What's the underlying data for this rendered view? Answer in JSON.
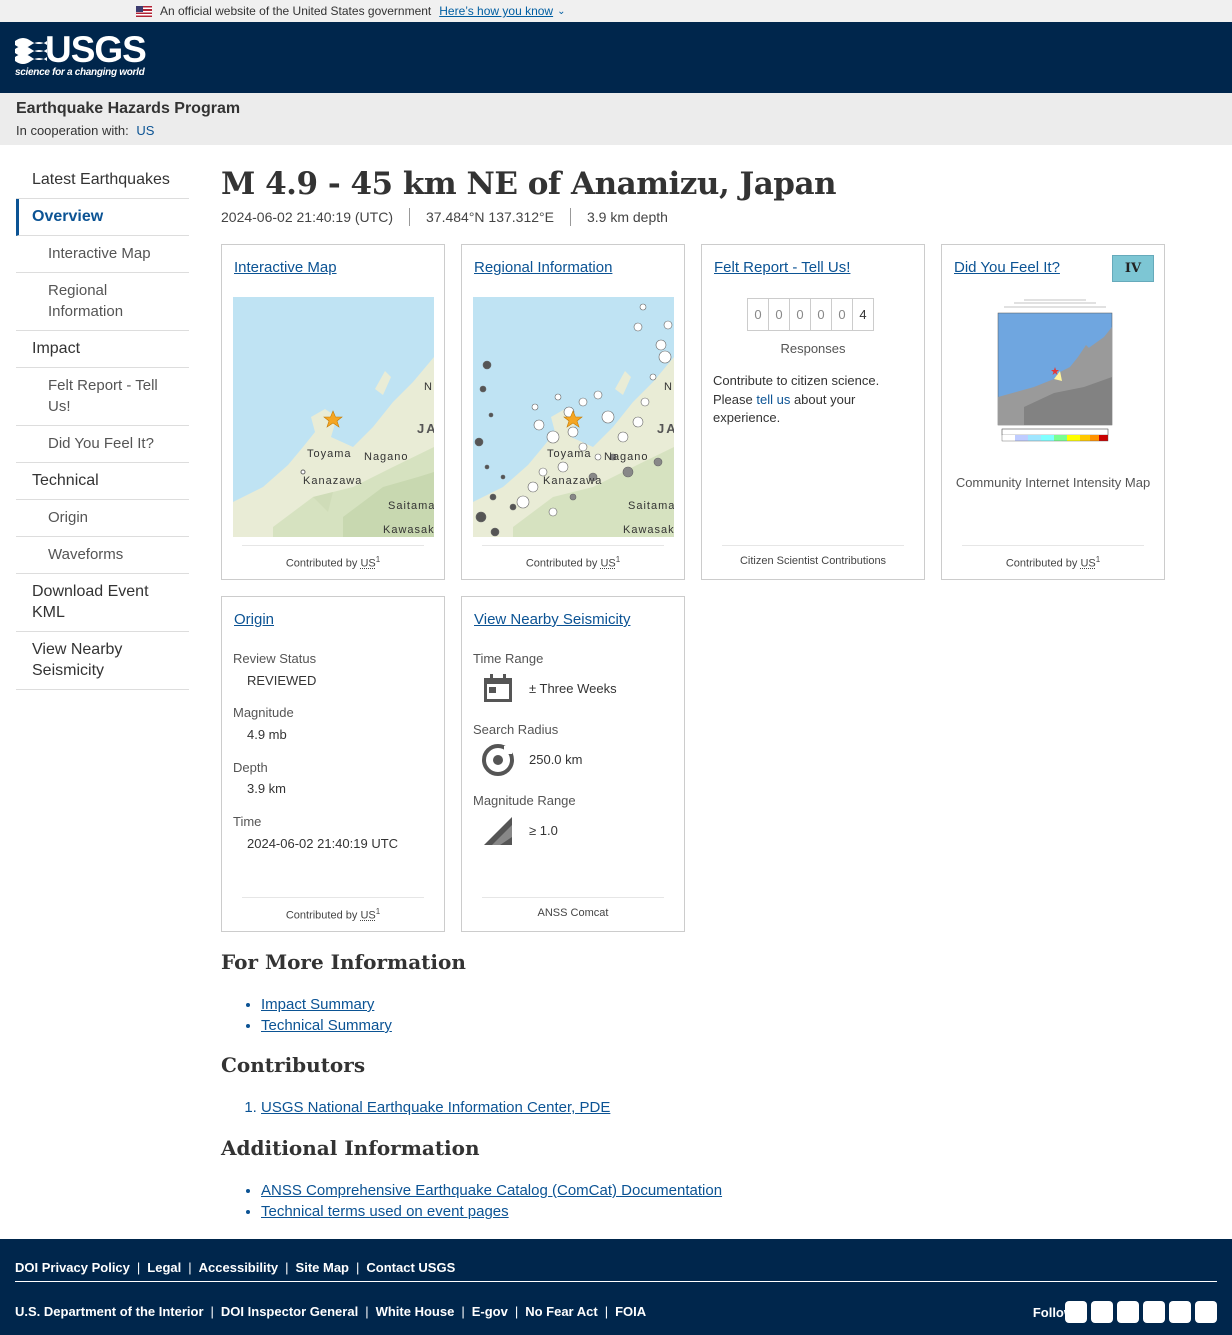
{
  "gov_banner": {
    "text": "An official website of the United States government",
    "link": "Here’s how you know"
  },
  "logo": {
    "wordmark": "USGS",
    "tagline": "science for a changing world"
  },
  "site_header": {
    "program": "Earthquake Hazards Program",
    "coop_label": "In cooperation with:",
    "coop_link": "US"
  },
  "sidebar": {
    "items": [
      {
        "label": "Latest Earthquakes"
      },
      {
        "label": "Overview"
      },
      {
        "label": "Interactive Map"
      },
      {
        "label": "Regional Information"
      },
      {
        "label": "Impact"
      },
      {
        "label": "Felt Report - Tell Us!"
      },
      {
        "label": "Did You Feel It?"
      },
      {
        "label": "Technical"
      },
      {
        "label": "Origin"
      },
      {
        "label": "Waveforms"
      },
      {
        "label": "Download Event KML"
      },
      {
        "label": "View Nearby Seismicity"
      }
    ]
  },
  "event": {
    "title": "M 4.9 - 45 km NE of Anamizu, Japan",
    "time": "2024-06-02 21:40:19 (UTC)",
    "location": "37.484°N 137.312°E",
    "depth": "3.9 km depth"
  },
  "cards": {
    "interactive_map": {
      "title": "Interactive Map",
      "footer_prefix": "Contributed by",
      "footer_net": "US",
      "footer_sup": "1"
    },
    "regional": {
      "title": "Regional Information",
      "footer_prefix": "Contributed by",
      "footer_net": "US",
      "footer_sup": "1"
    },
    "felt": {
      "title": "Felt Report - Tell Us!",
      "counter": [
        "0",
        "0",
        "0",
        "0",
        "0",
        "4"
      ],
      "responses_label": "Responses",
      "text_before": "Contribute to citizen science. Please ",
      "text_link": "tell us",
      "text_after": " about your experience.",
      "footer": "Citizen Scientist Contributions"
    },
    "dyfi": {
      "title": "Did You Feel It?",
      "badge": "IV",
      "caption": "Community Internet Intensity Map",
      "footer_prefix": "Contributed by",
      "footer_net": "US",
      "footer_sup": "1"
    },
    "origin": {
      "title": "Origin",
      "review_label": "Review Status",
      "review_value": "REVIEWED",
      "magnitude_label": "Magnitude",
      "magnitude_value": "4.9 mb",
      "depth_label": "Depth",
      "depth_value": "3.9 km",
      "time_label": "Time",
      "time_value": "2024-06-02 21:40:19 UTC",
      "footer_prefix": "Contributed by",
      "footer_net": "US",
      "footer_sup": "1"
    },
    "nearby": {
      "title": "View Nearby Seismicity",
      "time_label": "Time Range",
      "time_value": "± Three Weeks",
      "radius_label": "Search Radius",
      "radius_value": "250.0 km",
      "mag_label": "Magnitude Range",
      "mag_value": "≥ 1.0",
      "footer": "ANSS Comcat"
    }
  },
  "map_labels": [
    "Toyama",
    "Nagano",
    "Kanazawa",
    "Saitama",
    "Kawasaki",
    "JA",
    "N"
  ],
  "sections": {
    "more_info": {
      "heading": "For More Information",
      "links": [
        "Impact Summary",
        "Technical Summary"
      ]
    },
    "contributors": {
      "heading": "Contributors",
      "links": [
        "USGS National Earthquake Information Center, PDE"
      ]
    },
    "additional": {
      "heading": "Additional Information",
      "links": [
        "ANSS Comprehensive Earthquake Catalog (ComCat) Documentation",
        "Technical terms used on event pages"
      ]
    }
  },
  "footer": {
    "row1": [
      "DOI Privacy Policy",
      "Legal",
      "Accessibility",
      "Site Map",
      "Contact USGS"
    ],
    "row2": [
      "U.S. Department of the Interior",
      "DOI Inspector General",
      "White House",
      "E-gov",
      "No Fear Act",
      "FOIA"
    ],
    "follow": "Follow",
    "social_icons": [
      "twitter-icon",
      "facebook-icon",
      "github-icon",
      "flickr-icon",
      "youtube-icon",
      "instagram-icon"
    ]
  },
  "colors": {
    "header_bg": "#00264c",
    "link": "#0b5394",
    "intensity_iv": "#7dc6d4",
    "epicenter_star": "#f5a623"
  }
}
